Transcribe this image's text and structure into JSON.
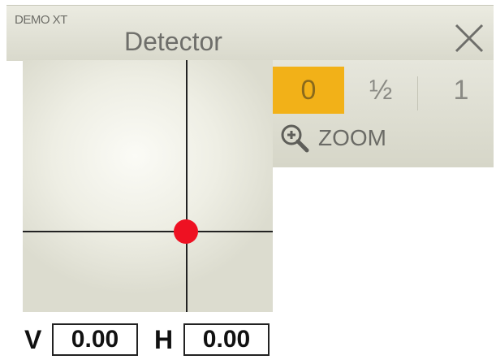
{
  "window": {
    "app_name": "DEMO XT",
    "title": "Detector",
    "close_icon": "close-icon"
  },
  "detector": {
    "crosshair_color": "#222222",
    "marker_color": "#ee1122"
  },
  "zoom": {
    "options": [
      "0",
      "½",
      "1"
    ],
    "selected": "0",
    "selected_color": "#f2b118",
    "label": "ZOOM",
    "icon": "zoom-in-icon"
  },
  "readouts": {
    "v_label": "V",
    "v_value": "0.00",
    "h_label": "H",
    "h_value": "0.00"
  }
}
